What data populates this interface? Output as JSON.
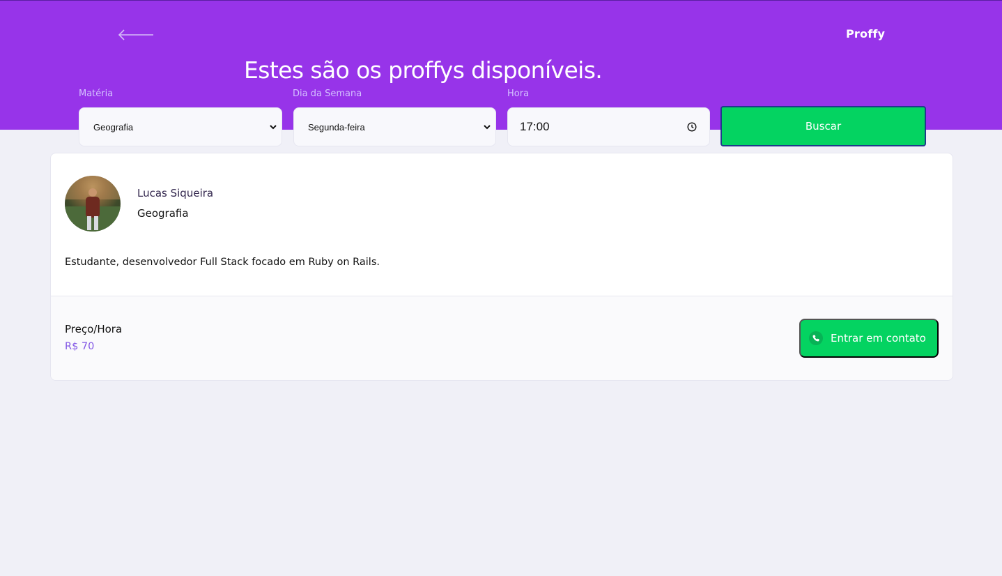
{
  "header": {
    "logo": "Proffy",
    "title": "Estes são os proffys disponíveis.",
    "back_icon": "arrow-left-icon"
  },
  "filters": {
    "subject": {
      "label": "Matéria",
      "value": "Geografia"
    },
    "weekday": {
      "label": "Dia da Semana",
      "value": "Segunda-feira"
    },
    "time": {
      "label": "Hora",
      "value": "17:00",
      "icon": "clock-icon"
    },
    "search_label": "Buscar"
  },
  "teacher": {
    "name": "Lucas Siqueira",
    "subject": "Geografia",
    "bio": "Estudante, desenvolvedor Full Stack focado em Ruby on Rails.",
    "price_label": "Preço/Hora",
    "price_value": "R$ 70",
    "contact_label": "Entrar em contato",
    "contact_icon": "whatsapp-icon"
  },
  "colors": {
    "primary": "#9734e9",
    "secondary": "#04d361",
    "background": "#f0f0f7",
    "price": "#8257e5"
  }
}
